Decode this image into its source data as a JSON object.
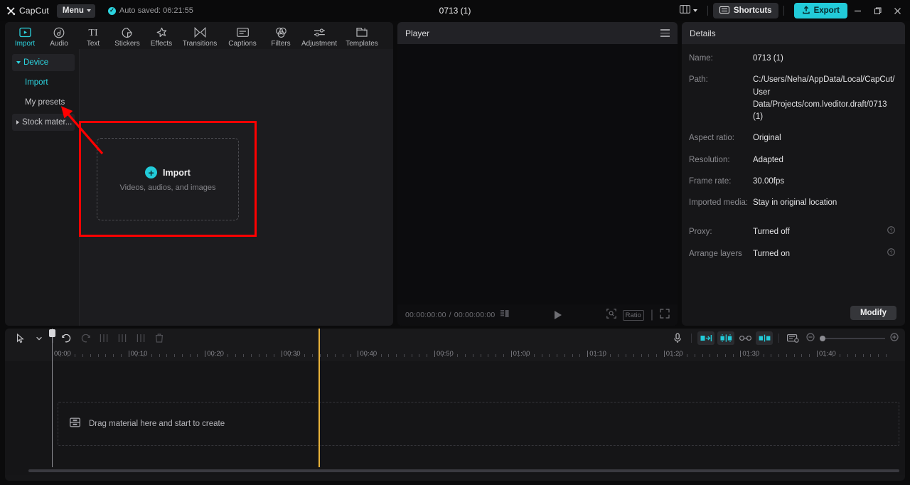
{
  "titlebar": {
    "logo_text": "CapCut",
    "menu_label": "Menu",
    "autosave_text": "Auto saved: 06:21:55",
    "project_title": "0713 (1)",
    "shortcuts_label": "Shortcuts",
    "export_label": "Export",
    "minimize_label": "–",
    "maximize_label": "❐",
    "close_label": "✕",
    "accent_color": "#22cbd9"
  },
  "toolbar": {
    "tabs": [
      {
        "label": "Import",
        "icon": "import-icon",
        "active": true
      },
      {
        "label": "Audio",
        "icon": "audio-icon",
        "active": false
      },
      {
        "label": "Text",
        "icon": "text-icon",
        "active": false
      },
      {
        "label": "Stickers",
        "icon": "stickers-icon",
        "active": false
      },
      {
        "label": "Effects",
        "icon": "effects-icon",
        "active": false
      },
      {
        "label": "Transitions",
        "icon": "transitions-icon",
        "active": false
      },
      {
        "label": "Captions",
        "icon": "captions-icon",
        "active": false
      },
      {
        "label": "Filters",
        "icon": "filters-icon",
        "active": false
      },
      {
        "label": "Adjustment",
        "icon": "adjustment-icon",
        "active": false
      },
      {
        "label": "Templates",
        "icon": "templates-icon",
        "active": false
      }
    ]
  },
  "sidebar": {
    "items": [
      {
        "label": "Device",
        "type": "group",
        "expanded": true,
        "active": true
      },
      {
        "label": "Import",
        "type": "child",
        "active": true
      },
      {
        "label": "My presets",
        "type": "child",
        "active": false
      },
      {
        "label": "Stock mater...",
        "type": "group",
        "expanded": false,
        "active": false
      }
    ]
  },
  "import_zone": {
    "title": "Import",
    "subtitle": "Videos, audios, and images",
    "plus_glyph": "+",
    "highlight_color": "#ff0000"
  },
  "player": {
    "title": "Player",
    "current_time": "00:00:00:00",
    "total_time": "00:00:00:00",
    "time_separator": "/",
    "ratio_label": "Ratio"
  },
  "details": {
    "title": "Details",
    "rows": [
      {
        "label": "Name:",
        "value": "0713 (1)"
      },
      {
        "label": "Path:",
        "value": "C:/Users/Neha/AppData/Local/CapCut/User Data/Projects/com.lveditor.draft/0713 (1)"
      },
      {
        "label": "Aspect ratio:",
        "value": "Original"
      },
      {
        "label": "Resolution:",
        "value": "Adapted"
      },
      {
        "label": "Frame rate:",
        "value": "30.00fps"
      },
      {
        "label": "Imported media:",
        "value": "Stay in original location"
      }
    ],
    "settings": [
      {
        "label": "Proxy:",
        "value": "Turned off",
        "help": "?"
      },
      {
        "label": "Arrange layers",
        "value": "Turned on",
        "help": "?"
      }
    ],
    "modify_label": "Modify"
  },
  "timeline": {
    "ruler_labels": [
      "00:00",
      "00:10",
      "00:20",
      "00:30",
      "00:40",
      "00:50",
      "01:00",
      "01:10",
      "01:20",
      "01:30",
      "01:40"
    ],
    "drop_text": "Drag material here and start to create",
    "playhead_time": "00:00",
    "marker_time": "00:34"
  }
}
